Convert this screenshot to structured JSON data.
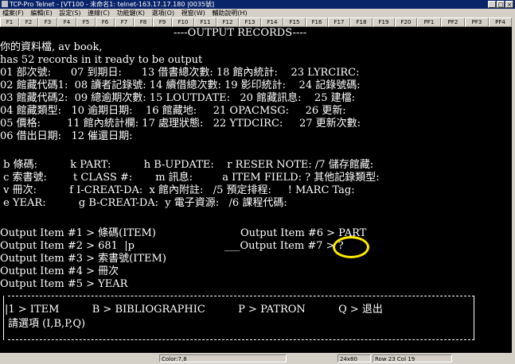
{
  "window": {
    "title": "TCP-Pro Telnet - [VT100 - 未命名1: telnet-163.17.17.180 |0035號]",
    "controls": [
      "_",
      "□",
      "×"
    ]
  },
  "menu": [
    "檔案(F)",
    "編輯(E)",
    "設定(S)",
    "連線(C)",
    "功能鍵(K)",
    "選項(O)",
    "視窗(W)",
    "輔助說明(H)"
  ],
  "function_keys": [
    "F1",
    "F2",
    "F3",
    "F4",
    "F5",
    "F6",
    "F7",
    "F8",
    "F9",
    "F10",
    "F11",
    "F12",
    "F13",
    "F14",
    "F15",
    "F16",
    "F17",
    "F18",
    "F19",
    "F20",
    "PF1",
    "PF2",
    "PF3",
    "PF4"
  ],
  "terminal": {
    "header": "----OUTPUT RECORDS----",
    "lines": [
      "你的資料檔, av book,",
      "has 52 records in it ready to be output",
      "01 部次號:      07 到期日:      13 借書總次數: 18 館內統計:    23 LYRCIRC:",
      "02 館藏代碼1:  08 讀者記錄號: 14 續借總次數: 19 影印統計:    24 記錄號碼:",
      "03 館藏代碼2:  09 總逾期次數: 15 LOUTDATE:   20 館藏訊息:    25 建檔:",
      "04 館藏類型:   10 逾期日期:    16 館藏地:     21 OPACMSG:     26 更新:",
      "05 價格:        11 館內統計欄: 17 處理狀態:   22 YTDCIRC:     27 更新次數:",
      "06 借出日期:   12 催還日期:",
      "",
      " b 條碼:          k PART:          h B-UPDATE:    r RESER NOTE: /7 儲存館藏:",
      " c 索書號:        t CLASS #:       m 訊息:         a ITEM FIELD: ? 其他記錄類型:",
      " v 冊次:          f I-CREAT-DA:  x 館內附註:   /5 預定排程:     ! MARC Tag:",
      " e YEAR:          g B-CREAT-DA:  y 電子資源:   /6 課程代碼:",
      "",
      "Output Item #1 > 條碼(ITEM)",
      "Output Item #2 > 681  |p",
      "Output Item #3 > 索書號(ITEM)",
      "Output Item #4 > 冊次",
      "Output Item #5 > YEAR"
    ],
    "right_col": [
      "Output Item #6 > PART",
      "___Output Item #7 > ?"
    ],
    "box": {
      "line1": "|1 > ITEM          B > BIBLIOGRAPHIC          P > PATRON          Q > 退出",
      "line2": "請選項 (I,B,P,Q)"
    }
  },
  "status_bar": {
    "color": "Color:7,8",
    "size": "24x80",
    "position": "Row 23 Col 19"
  }
}
